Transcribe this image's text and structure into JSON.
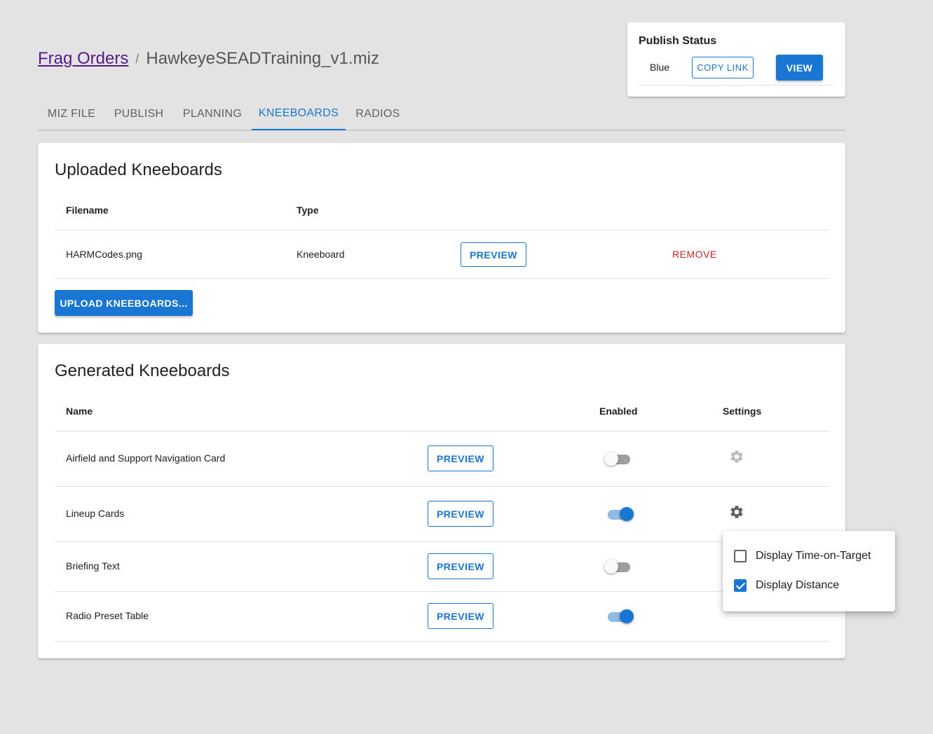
{
  "breadcrumb": {
    "link": "Frag Orders",
    "separator": "/",
    "current": "HawkeyeSEADTraining_v1.miz"
  },
  "publish": {
    "title": "Publish Status",
    "team": "Blue",
    "copy_link": "COPY LINK",
    "view": "VIEW"
  },
  "tabs": [
    {
      "label": "MIZ FILE"
    },
    {
      "label": "PUBLISH"
    },
    {
      "label": "PLANNING"
    },
    {
      "label": "KNEEBOARDS",
      "active": true
    },
    {
      "label": "RADIOS"
    }
  ],
  "uploaded": {
    "title": "Uploaded Kneeboards",
    "headers": {
      "filename": "Filename",
      "type": "Type"
    },
    "rows": [
      {
        "filename": "HARMCodes.png",
        "type": "Kneeboard",
        "preview": "PREVIEW",
        "remove": "REMOVE"
      }
    ],
    "upload_button": "UPLOAD KNEEBOARDS..."
  },
  "generated": {
    "title": "Generated Kneeboards",
    "headers": {
      "name": "Name",
      "enabled": "Enabled",
      "settings": "Settings"
    },
    "rows": [
      {
        "name": "Airfield and Support Navigation Card",
        "preview": "PREVIEW",
        "enabled": false,
        "settings_icon": "gear-icon"
      },
      {
        "name": "Lineup Cards",
        "preview": "PREVIEW",
        "enabled": true,
        "settings_icon": "gear-icon"
      },
      {
        "name": "Briefing Text",
        "preview": "PREVIEW",
        "enabled": false
      },
      {
        "name": "Radio Preset Table",
        "preview": "PREVIEW",
        "enabled": true
      }
    ]
  },
  "settings_popover": {
    "options": [
      {
        "label": "Display Time-on-Target",
        "checked": false
      },
      {
        "label": "Display Distance",
        "checked": true
      }
    ]
  },
  "colors": {
    "primary": "#1976d2",
    "danger": "#c62828",
    "background": "#e3e3e3"
  }
}
